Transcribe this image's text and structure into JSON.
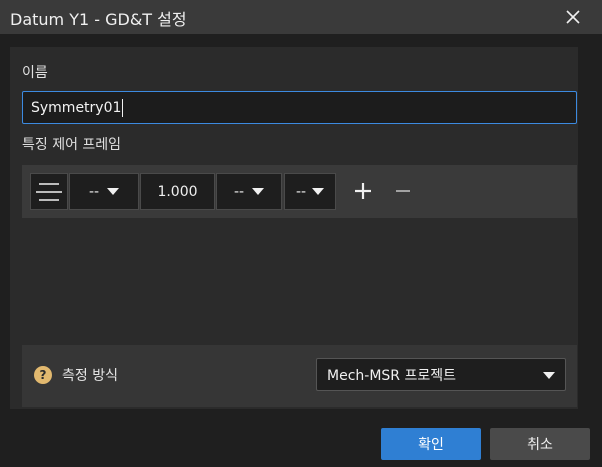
{
  "window": {
    "title": "Datum Y1 - GD&T 설정",
    "close_icon": "close-icon"
  },
  "name_section": {
    "label": "이름",
    "value": "Symmetry01"
  },
  "fcf_section": {
    "label": "특징 제어 프레임",
    "symbol_icon": "symmetry-icon",
    "dropdown1": "--",
    "tolerance": "1.000",
    "dropdown2": "--",
    "dropdown3": "--",
    "add_icon": "plus-icon",
    "remove_icon": "minus-icon"
  },
  "measurement": {
    "help_icon": "help-icon",
    "help_glyph": "?",
    "label": "측정 방식",
    "selected": "Mech-MSR 프로젝트"
  },
  "buttons": {
    "ok": "확인",
    "cancel": "취소"
  },
  "colors": {
    "accent": "#2f7fd3",
    "help": "#e2b96f"
  }
}
